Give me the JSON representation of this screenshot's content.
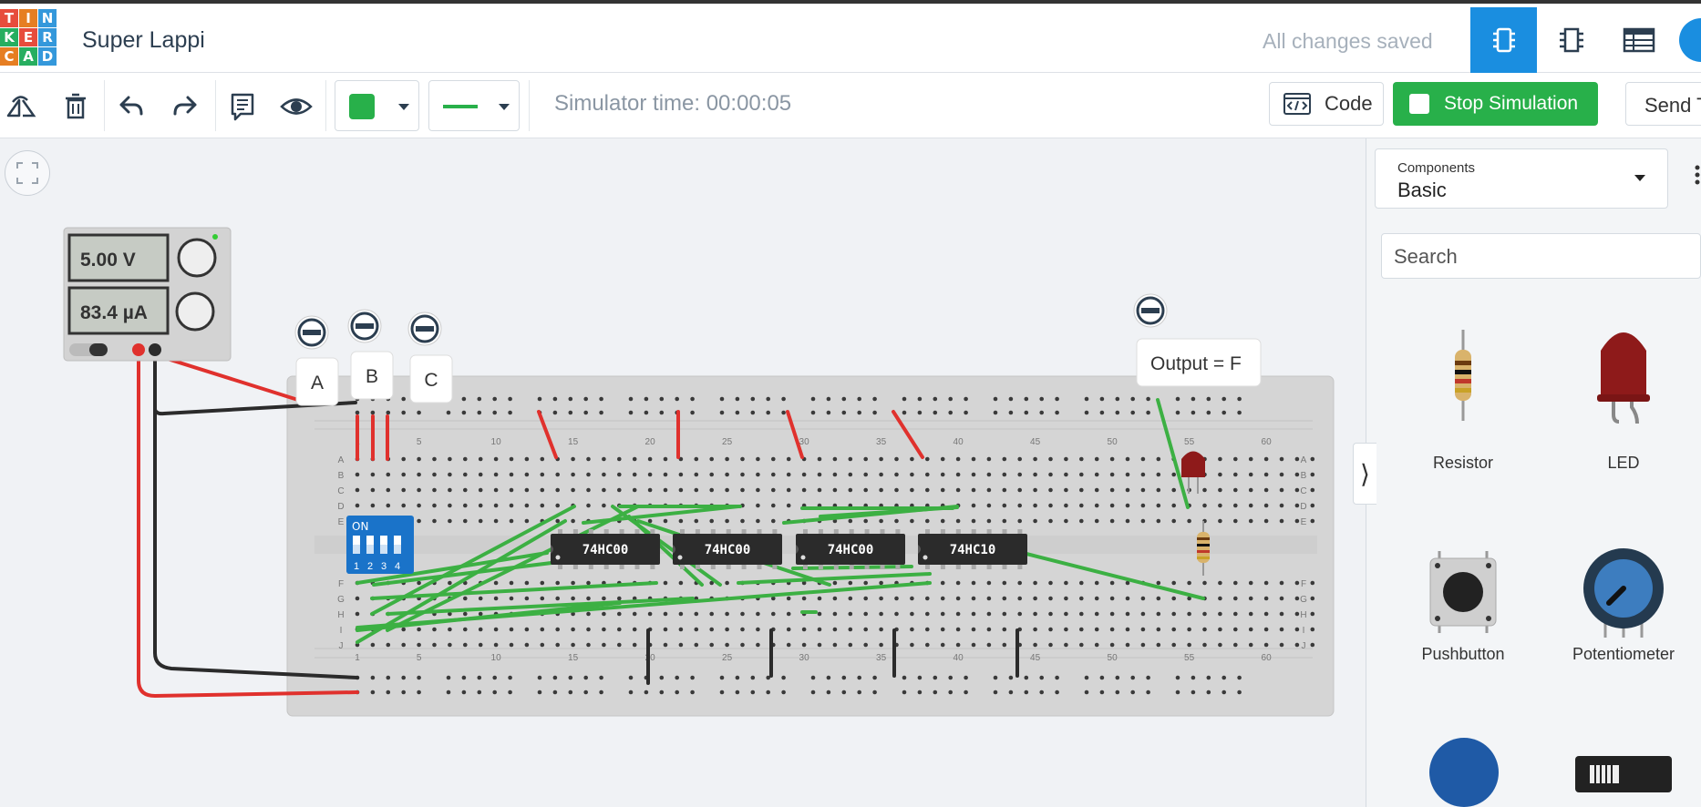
{
  "header": {
    "logo_letters": [
      "T",
      "I",
      "N",
      "K",
      "E",
      "R",
      "C",
      "A",
      "D"
    ],
    "logo_colors": [
      "#e74c3c",
      "#e67e22",
      "#3498db",
      "#27ae60",
      "#e74c3c",
      "#3498db",
      "#e67e22",
      "#27ae60",
      "#3498db"
    ],
    "design_title": "Super Lappi",
    "save_status": "All changes saved",
    "views": [
      {
        "name": "circuit-view",
        "icon": "chip-icon",
        "active": true
      },
      {
        "name": "schematic-view",
        "icon": "schematic-icon",
        "active": false
      },
      {
        "name": "component-list-view",
        "icon": "table-icon",
        "active": false
      }
    ],
    "accent": "#1a8ee0"
  },
  "toolbar": {
    "tools": [
      "rotate-icon",
      "trash-icon",
      "undo-icon",
      "redo-icon",
      "notes-icon",
      "eye-icon"
    ],
    "wire_color": "#28b04a",
    "simulator_time": "Simulator time: 00:00:05",
    "code_label": "Code",
    "stop_label": "Stop Simulation",
    "send_label": "Send T"
  },
  "power_supply": {
    "voltage": "5.00 V",
    "current": "83.4 µA"
  },
  "switches": [
    "A",
    "B",
    "C"
  ],
  "output_label": "Output = F",
  "breadboard": {
    "row_letters": [
      "A",
      "B",
      "C",
      "D",
      "E",
      "F",
      "G",
      "H",
      "I",
      "J"
    ],
    "column_numbers": [
      "1",
      "5",
      "10",
      "15",
      "20",
      "25",
      "30",
      "35",
      "40",
      "45",
      "50",
      "55",
      "60"
    ],
    "dip_switch": {
      "title": "ON",
      "positions": [
        "1",
        "2",
        "3",
        "4"
      ]
    },
    "chips": [
      "74HC00",
      "74HC00",
      "74HC00",
      "74HC10"
    ]
  },
  "panel": {
    "selector_label": "Components",
    "selector_value": "Basic",
    "search_placeholder": "Search",
    "components": [
      {
        "label": "Resistor",
        "icon": "resistor-icon"
      },
      {
        "label": "LED",
        "icon": "led-icon"
      },
      {
        "label": "Pushbutton",
        "icon": "pushbutton-icon"
      },
      {
        "label": "Potentiometer",
        "icon": "potentiometer-icon"
      }
    ]
  }
}
